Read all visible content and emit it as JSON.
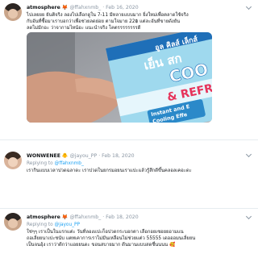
{
  "tweets": [
    {
      "name": "atmosphere",
      "emoji": "🦊",
      "handle": "@ffahxnmb_",
      "date": "Feb 16, 2020",
      "lines": [
        "ไปเลยยย ยันติจริง ลองไปเลือกดูใน 7-11 มีหลายแบบมาก ยิ่งใหม่เพื่อตลาดใช้จริง",
        "กับอันที่ซื้อมาเราบอกว่าเพื่อช่วยลดย่อย ตามใจมาย 22฿ แต่ละอันที่ขายดังยัน",
        "ลดไม่มีกอะ ว่าจากามไหน้อะ แนะนำจริง โคตรรรรรรรรดี"
      ],
      "photo_text": [
        "อูล คิลส์ เล็กส์",
        "เย็น สก",
        "COO",
        "& REFRESH",
        "Instant and E",
        "Cooling Effe"
      ]
    },
    {
      "name": "WONWENEE",
      "emoji": "🐥",
      "handle": "@jayou_PP",
      "date": "Feb 18, 2020",
      "reply_to": "@ffahxnmb_",
      "replying_label": "Replying to",
      "lines": [
        "เรากินแบบเวลาปวดฉลาดะ เราปวดในยกรมอยนเราแปะแล้วรู้สึกดีขึ้นคลอลเคอะดะ"
      ]
    },
    {
      "name": "atmosphere",
      "emoji": "🦊",
      "handle": "@ffahxnmb_",
      "date": "Feb 18, 2020",
      "reply_to": "@jayou_PP",
      "replying_label": "Replying to",
      "lines": [
        "ใช่ๆๆ เราเป็นในแรกแต่ะ วันที่ลองแปะก็อปวดกระบอกตา เลือกอยเซอยยอามแน",
        "ถอเลี่ยยนาเปะชนับ แตทเคาการเราไม่มีนเหลือนไม่ช่วยแต่ว 55555 เดอออมนเลี่ยยน",
        "เป็นจนอุ้ง เราว่าดีกว่าแอยยนดะ ขอนสบายมาก ดีนมานแบบสดชื่นนนน 🥰"
      ]
    }
  ],
  "colors": {
    "link": "#1da1f2",
    "muted": "#8a96a3",
    "divider": "#e6ecf0"
  }
}
